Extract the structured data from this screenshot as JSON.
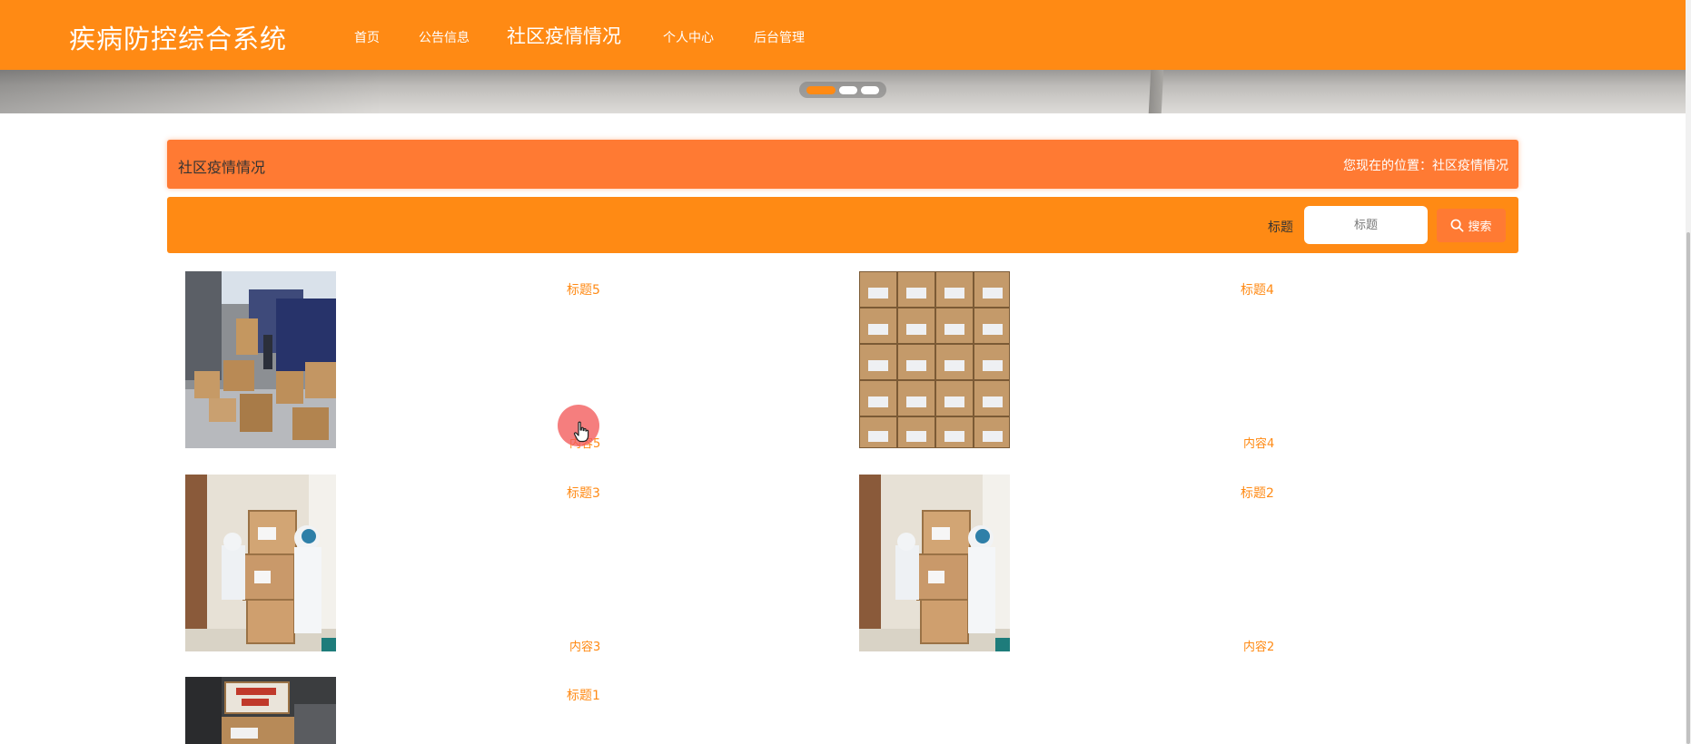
{
  "header": {
    "brand": "疾病防控综合系统",
    "nav": [
      {
        "label": "首页",
        "active": false
      },
      {
        "label": "公告信息",
        "active": false
      },
      {
        "label": "社区疫情情况",
        "active": true
      },
      {
        "label": "个人中心",
        "active": false
      },
      {
        "label": "后台管理",
        "active": false
      }
    ]
  },
  "carousel": {
    "slide_count": 3,
    "active_slide": 1
  },
  "page": {
    "title": "社区疫情情况",
    "location": "您现在的位置：社区疫情情况"
  },
  "search": {
    "label": "标题",
    "placeholder": "标题",
    "value": "",
    "button_label": "搜索",
    "button_icon": "search-icon"
  },
  "items": [
    {
      "title": "标题5",
      "content": "内容5"
    },
    {
      "title": "标题4",
      "content": "内容4"
    },
    {
      "title": "标题3",
      "content": "内容3"
    },
    {
      "title": "标题2",
      "content": "内容2"
    },
    {
      "title": "标题1",
      "content": ""
    }
  ],
  "colors": {
    "primary": "#ff8a14",
    "accent": "#ff7a33",
    "text_dark": "#333333",
    "cursor": "#f25a5a"
  }
}
